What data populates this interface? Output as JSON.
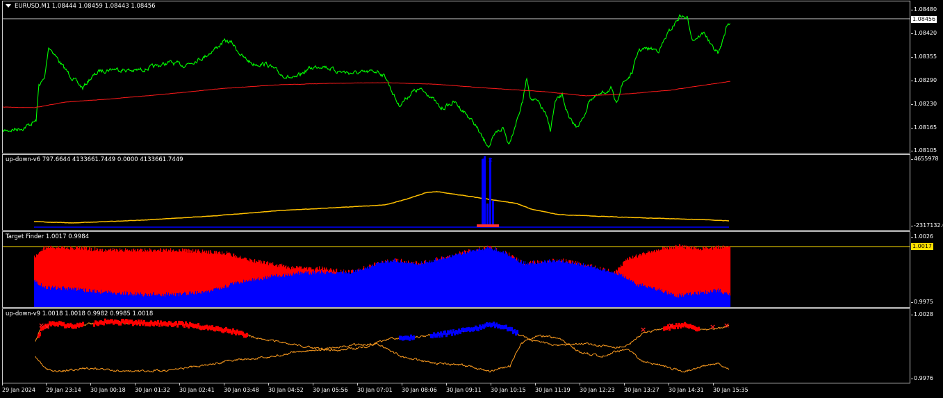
{
  "colors": {
    "price": "#00ff00",
    "ma": "#ff1a1a",
    "osc": "#ffc000",
    "blue": "#0000ff",
    "red": "#ff0000",
    "orange": "#ff9d1f",
    "cross_red": "#ff2020",
    "current_badge_bg": "#ffffff",
    "target_badge_bg": "#ffe000"
  },
  "main": {
    "title": "EURUSD,M1  1.08444 1.08459 1.08443 1.08456",
    "price_axis": [
      "1.08480",
      "1.08420",
      "1.08355",
      "1.08290",
      "1.08230",
      "1.08165",
      "1.08105"
    ],
    "current_price": "1.08456"
  },
  "ind1": {
    "title": "up-down-v6 797.6644 4133661.7449 0.0000 4133661.7449",
    "axis_top": "4655978",
    "axis_bottom": "-2317132.6"
  },
  "ind2": {
    "title": "Target Finder 1.0017 0.9984",
    "axis_top": "1.0026",
    "level": "1.0017",
    "axis_bottom": "0.9975"
  },
  "ind3": {
    "title": "up-down-v9 1.0018 1.0018 0.9982 0.9985 1.0018",
    "axis_top": "1.0028",
    "axis_bottom": "0.9976"
  },
  "time_axis": [
    "29 Jan 2024",
    "29 Jan 23:14",
    "30 Jan 00:18",
    "30 Jan 01:32",
    "30 Jan 02:41",
    "30 Jan 03:48",
    "30 Jan 04:52",
    "30 Jan 05:56",
    "30 Jan 07:01",
    "30 Jan 08:06",
    "30 Jan 09:11",
    "30 Jan 10:15",
    "30 Jan 11:19",
    "30 Jan 12:23",
    "30 Jan 13:27",
    "30 Jan 14:31",
    "30 Jan 15:35"
  ]
}
